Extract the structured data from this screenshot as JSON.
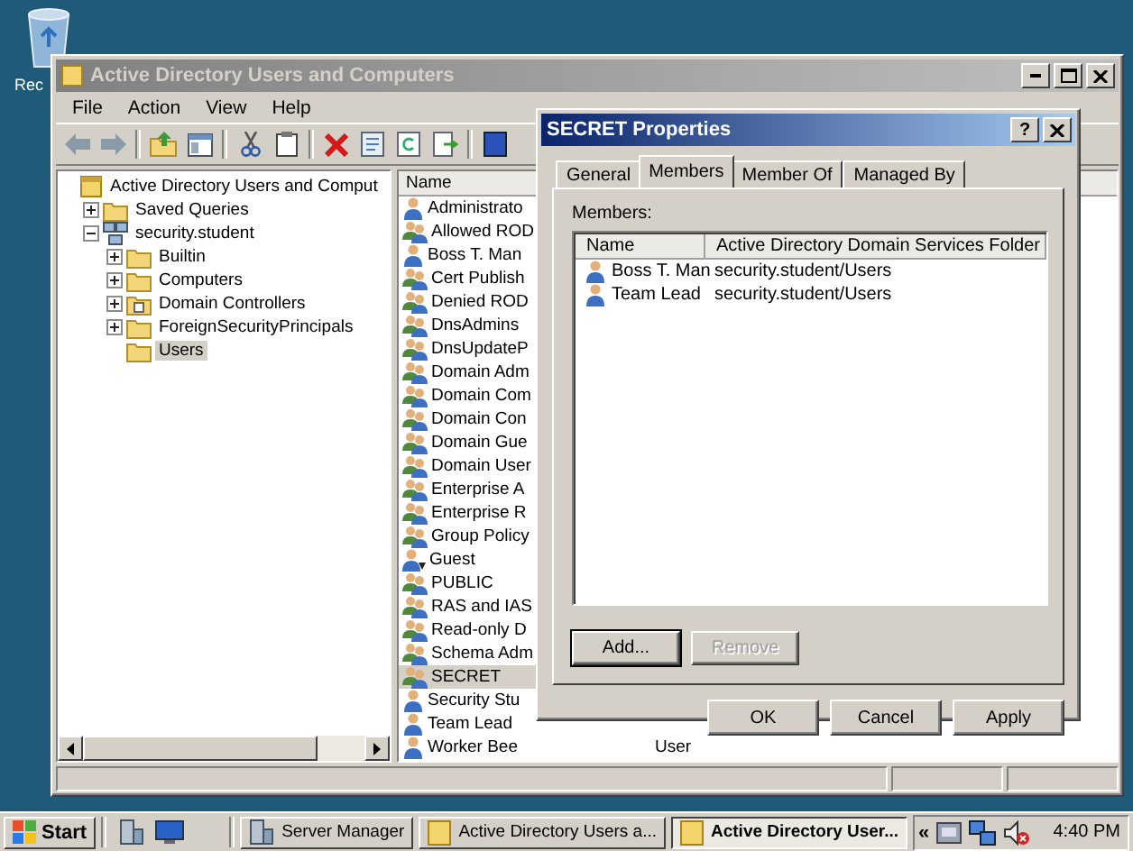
{
  "desktop": {
    "icons": [
      {
        "label": "Rec"
      }
    ]
  },
  "window": {
    "title": "Active Directory Users and Computers",
    "active": false,
    "menu": [
      "File",
      "Action",
      "View",
      "Help"
    ],
    "tree": {
      "items": [
        {
          "label": "Active Directory Users and Comput",
          "kind": "console",
          "selected": false,
          "children": [
            {
              "label": "Saved Queries",
              "kind": "folder",
              "selected": false,
              "expanded": false
            },
            {
              "label": "security.student",
              "kind": "domain",
              "selected": false,
              "expanded": true,
              "children": [
                {
                  "label": "Builtin",
                  "kind": "folder",
                  "selected": false,
                  "expanded": false
                },
                {
                  "label": "Computers",
                  "kind": "folder",
                  "selected": false,
                  "expanded": false
                },
                {
                  "label": "Domain Controllers",
                  "kind": "ou",
                  "selected": false,
                  "expanded": false
                },
                {
                  "label": "ForeignSecurityPrincipals",
                  "kind": "folder",
                  "selected": false,
                  "expanded": false
                },
                {
                  "label": "Users",
                  "kind": "folder",
                  "selected": true
                }
              ]
            }
          ]
        }
      ]
    },
    "list": {
      "columns": [
        "Name"
      ],
      "rows": [
        {
          "name": "Administrato",
          "kind": "user",
          "selected": false
        },
        {
          "name": "Allowed ROD",
          "kind": "group",
          "selected": false
        },
        {
          "name": "Boss T. Man",
          "kind": "user",
          "selected": false
        },
        {
          "name": "Cert Publish",
          "kind": "group",
          "selected": false
        },
        {
          "name": "Denied ROD",
          "kind": "group",
          "selected": false
        },
        {
          "name": "DnsAdmins",
          "kind": "group",
          "selected": false
        },
        {
          "name": "DnsUpdateP",
          "kind": "group",
          "selected": false
        },
        {
          "name": "Domain Adm",
          "kind": "group",
          "selected": false
        },
        {
          "name": "Domain Com",
          "kind": "group",
          "selected": false
        },
        {
          "name": "Domain Con",
          "kind": "group",
          "selected": false
        },
        {
          "name": "Domain Gue",
          "kind": "group",
          "selected": false
        },
        {
          "name": "Domain User",
          "kind": "group",
          "selected": false
        },
        {
          "name": "Enterprise A",
          "kind": "group",
          "selected": false
        },
        {
          "name": "Enterprise R",
          "kind": "group",
          "selected": false
        },
        {
          "name": "Group Policy",
          "kind": "group",
          "selected": false
        },
        {
          "name": "Guest",
          "kind": "user-disabled",
          "selected": false
        },
        {
          "name": "PUBLIC",
          "kind": "group",
          "selected": false
        },
        {
          "name": "RAS and IAS",
          "kind": "group",
          "selected": false
        },
        {
          "name": "Read-only D",
          "kind": "group",
          "selected": false
        },
        {
          "name": "Schema Adm",
          "kind": "group",
          "selected": false
        },
        {
          "name": "SECRET",
          "kind": "group",
          "selected": true
        },
        {
          "name": "Security Stu",
          "kind": "user",
          "selected": false
        },
        {
          "name": "Team Lead",
          "kind": "user",
          "selected": false
        },
        {
          "name": "Worker Bee",
          "kind": "user",
          "selected": false,
          "column_2": "User"
        }
      ]
    }
  },
  "dialog": {
    "title": "SECRET Properties",
    "active": true,
    "help_button": "?",
    "tabs": [
      {
        "label": "General",
        "selected": false
      },
      {
        "label": "Members",
        "selected": true
      },
      {
        "label": "Member Of",
        "selected": false
      },
      {
        "label": "Managed By",
        "selected": false
      }
    ],
    "members_label": "Members:",
    "members_table": {
      "columns": [
        "Name",
        "Active Directory Domain Services Folder"
      ],
      "rows": [
        {
          "name": "Boss T. Man",
          "folder": "security.student/Users",
          "selected": false
        },
        {
          "name": "Team Lead",
          "folder": "security.student/Users",
          "selected": false
        }
      ]
    },
    "buttons": [
      {
        "label": "Add...",
        "disabled": false,
        "focused": true
      },
      {
        "label": "Remove",
        "disabled": true,
        "focused": false
      }
    ],
    "footer_buttons": [
      {
        "label": "OK",
        "disabled": false
      },
      {
        "label": "Cancel",
        "disabled": false
      },
      {
        "label": "Apply",
        "disabled": false
      }
    ]
  },
  "taskbar": {
    "start": "Start",
    "tasks": [
      {
        "label": "Server Manager",
        "kind": "server",
        "selected": false
      },
      {
        "label": "Active Directory Users a...",
        "kind": "console",
        "selected": false
      },
      {
        "label": "Active Directory User...",
        "kind": "console",
        "selected": true
      }
    ],
    "tray_expand": "«",
    "clock": "4:40 PM"
  }
}
